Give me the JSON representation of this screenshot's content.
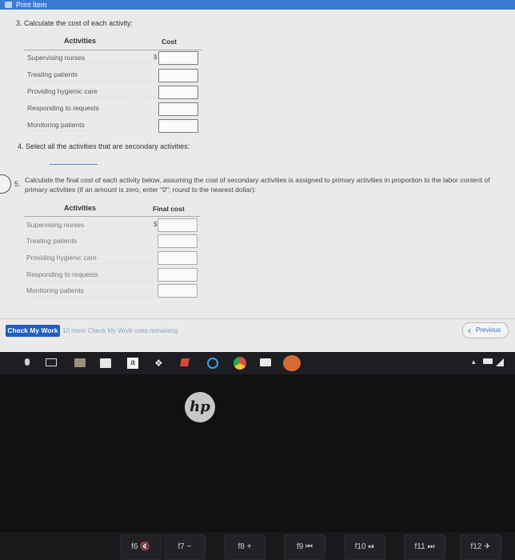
{
  "window": {
    "title": "Print Item"
  },
  "q3": {
    "prompt": "3. Calculate the cost of each activity:",
    "col_activities": "Activities",
    "col_cost": "Cost",
    "currency": "$",
    "rows": [
      "Supervising nurses",
      "Treating patients",
      "Providing hygienic care",
      "Responding to requests",
      "Monitoring patients"
    ]
  },
  "q4": {
    "prompt": "4. Select all the activities that are secondary activities:"
  },
  "q5": {
    "number": "5.",
    "prompt": "Calculate the final cost of each activity below, assuming the cost of secondary activities is assigned to primary activities in proportion to the labor content of primary activities (if an amount is zero, enter \"0\"; round to the nearest dollar):",
    "col_activities": "Activities",
    "col_final_cost": "Final cost",
    "currency": "$",
    "rows": [
      "Supervising nurses",
      "Treating patients",
      "Providing hygienic care",
      "Responding to requests",
      "Monitoring patients"
    ]
  },
  "footer": {
    "check_label": "Check My Work",
    "remaining": "10 more Check My Work uses remaining",
    "previous_label": "Previous"
  },
  "keyboard": {
    "keys": [
      "f6",
      "f7",
      "f8",
      "f9",
      "f10",
      "f11",
      "f12"
    ]
  },
  "colors": {
    "accent": "#1f5fbf",
    "titlebar": "#3b7bd6"
  }
}
